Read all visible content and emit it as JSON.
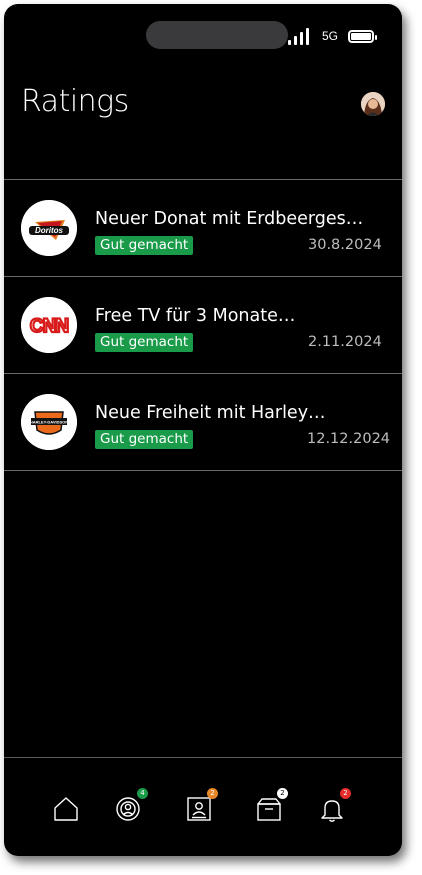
{
  "status": {
    "network": "5G"
  },
  "header": {
    "title": "Ratings"
  },
  "ratings": [
    {
      "brand": "Doritos",
      "logo_text": "Doritos",
      "title": "Neuer Donat mit Erdbeerges…",
      "badge": "Gut gemacht",
      "date": "30.8.2024"
    },
    {
      "brand": "CNN",
      "logo_text": "CNN",
      "title": "Free TV für 3 Monate…",
      "badge": "Gut gemacht",
      "date": "2.11.2024"
    },
    {
      "brand": "Harley-Davidson",
      "logo_text": "HARLEY-DAVIDSON",
      "title": "Neue Freiheit mit Harley…",
      "badge": "Gut gemacht",
      "date": "12.12.2024"
    }
  ],
  "tabbar": {
    "items": [
      {
        "icon": "home-icon",
        "badge": ""
      },
      {
        "icon": "radar-user-icon",
        "badge": "4",
        "badge_color": "#1a9b4a"
      },
      {
        "icon": "contact-card-icon",
        "badge": "2",
        "badge_color": "#e8872a"
      },
      {
        "icon": "box-icon",
        "badge": "2",
        "badge_color": "#ffffff"
      },
      {
        "icon": "bell-icon",
        "badge": "2",
        "badge_color": "#e52b2b"
      }
    ]
  },
  "colors": {
    "badge_green": "#1a9b4a",
    "background": "#000000",
    "divider": "#6a6a6a"
  }
}
